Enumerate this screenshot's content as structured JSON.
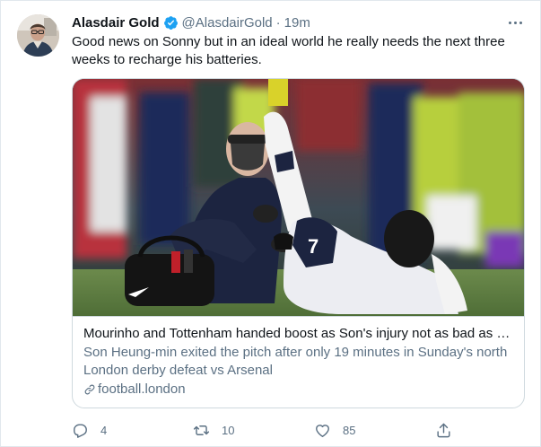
{
  "author": {
    "name": "Alasdair Gold",
    "handle": "@AlasdairGold",
    "separator": "·",
    "time": "19m",
    "verified_icon": "verified-badge-icon"
  },
  "tweet": {
    "text": "Good news on Sonny but in an ideal world he really needs the next three weeks to recharge his batteries."
  },
  "card": {
    "image_icon": "football-player-injury-photo",
    "title": "Mourinho and Tottenham handed boost as Son's injury not as bad as fi...",
    "description": "Son Heung-min exited the pitch after only 19 minutes in Sunday's north London derby defeat vs Arsenal",
    "domain": "football.london"
  },
  "actions": {
    "reply_count": "4",
    "retweet_count": "10",
    "like_count": "85"
  },
  "colors": {
    "text_primary": "#0f1419",
    "text_secondary": "#5b7083",
    "verified_blue": "#1da1f2",
    "border": "#cfd9de"
  }
}
